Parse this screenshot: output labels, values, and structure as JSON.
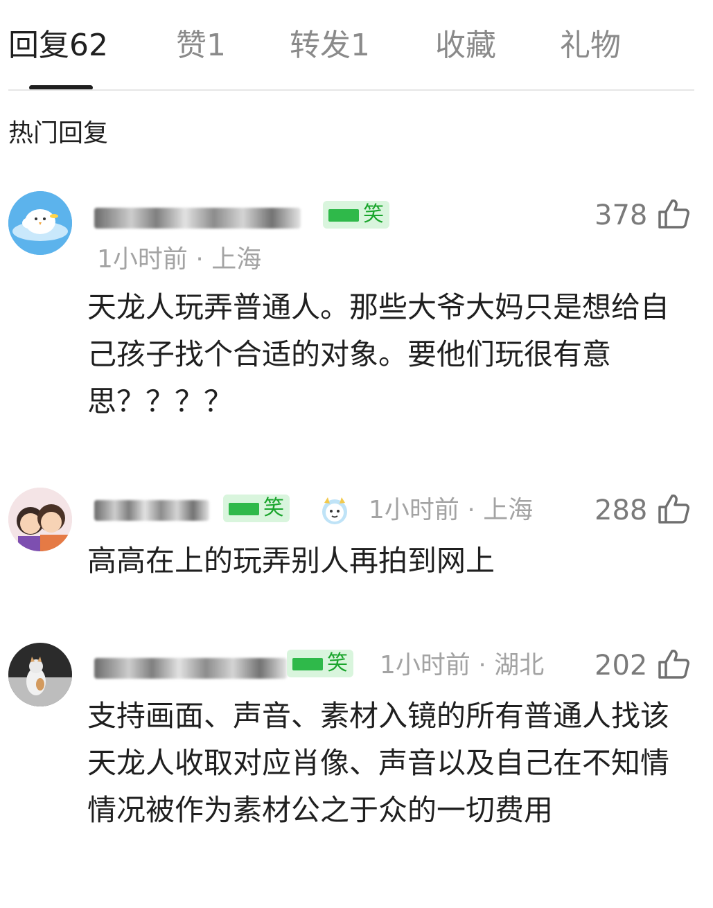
{
  "tabs": [
    {
      "label": "回复62"
    },
    {
      "label": "赞1"
    },
    {
      "label": "转发1"
    },
    {
      "label": "收藏"
    },
    {
      "label": "礼物"
    }
  ],
  "section_title": "热门回复",
  "comments": [
    {
      "badge": "笑",
      "meta": "1小时前 · 上海",
      "likes": "378",
      "content": "天龙人玩弄普通人。那些大爷大妈只是想给自己孩子找个合适的对象。要他们玩很有意思？？？？"
    },
    {
      "badge": "笑",
      "meta": "1小时前 · 上海",
      "likes": "288",
      "content": "高高在上的玩弄别人再拍到网上"
    },
    {
      "badge": "笑",
      "meta": "1小时前 · 湖北",
      "likes": "202",
      "content": "支持画面、声音、素材入镜的所有普通人找该天龙人收取对应肖像、声音以及自己在不知情情况被作为素材公之于众的一切费用"
    }
  ],
  "icons": {
    "like": "thumb-up-icon",
    "avatar1": "cartoon-bird-avatar",
    "avatar2": "two-people-avatar",
    "avatar3": "cat-photo-avatar",
    "sticker": "cat-sticker-icon"
  },
  "colors": {
    "text": "#1f1f1f",
    "muted": "#a3a3a3",
    "badge_bg": "#d9f5dd",
    "badge_fg": "#1aa52c"
  }
}
